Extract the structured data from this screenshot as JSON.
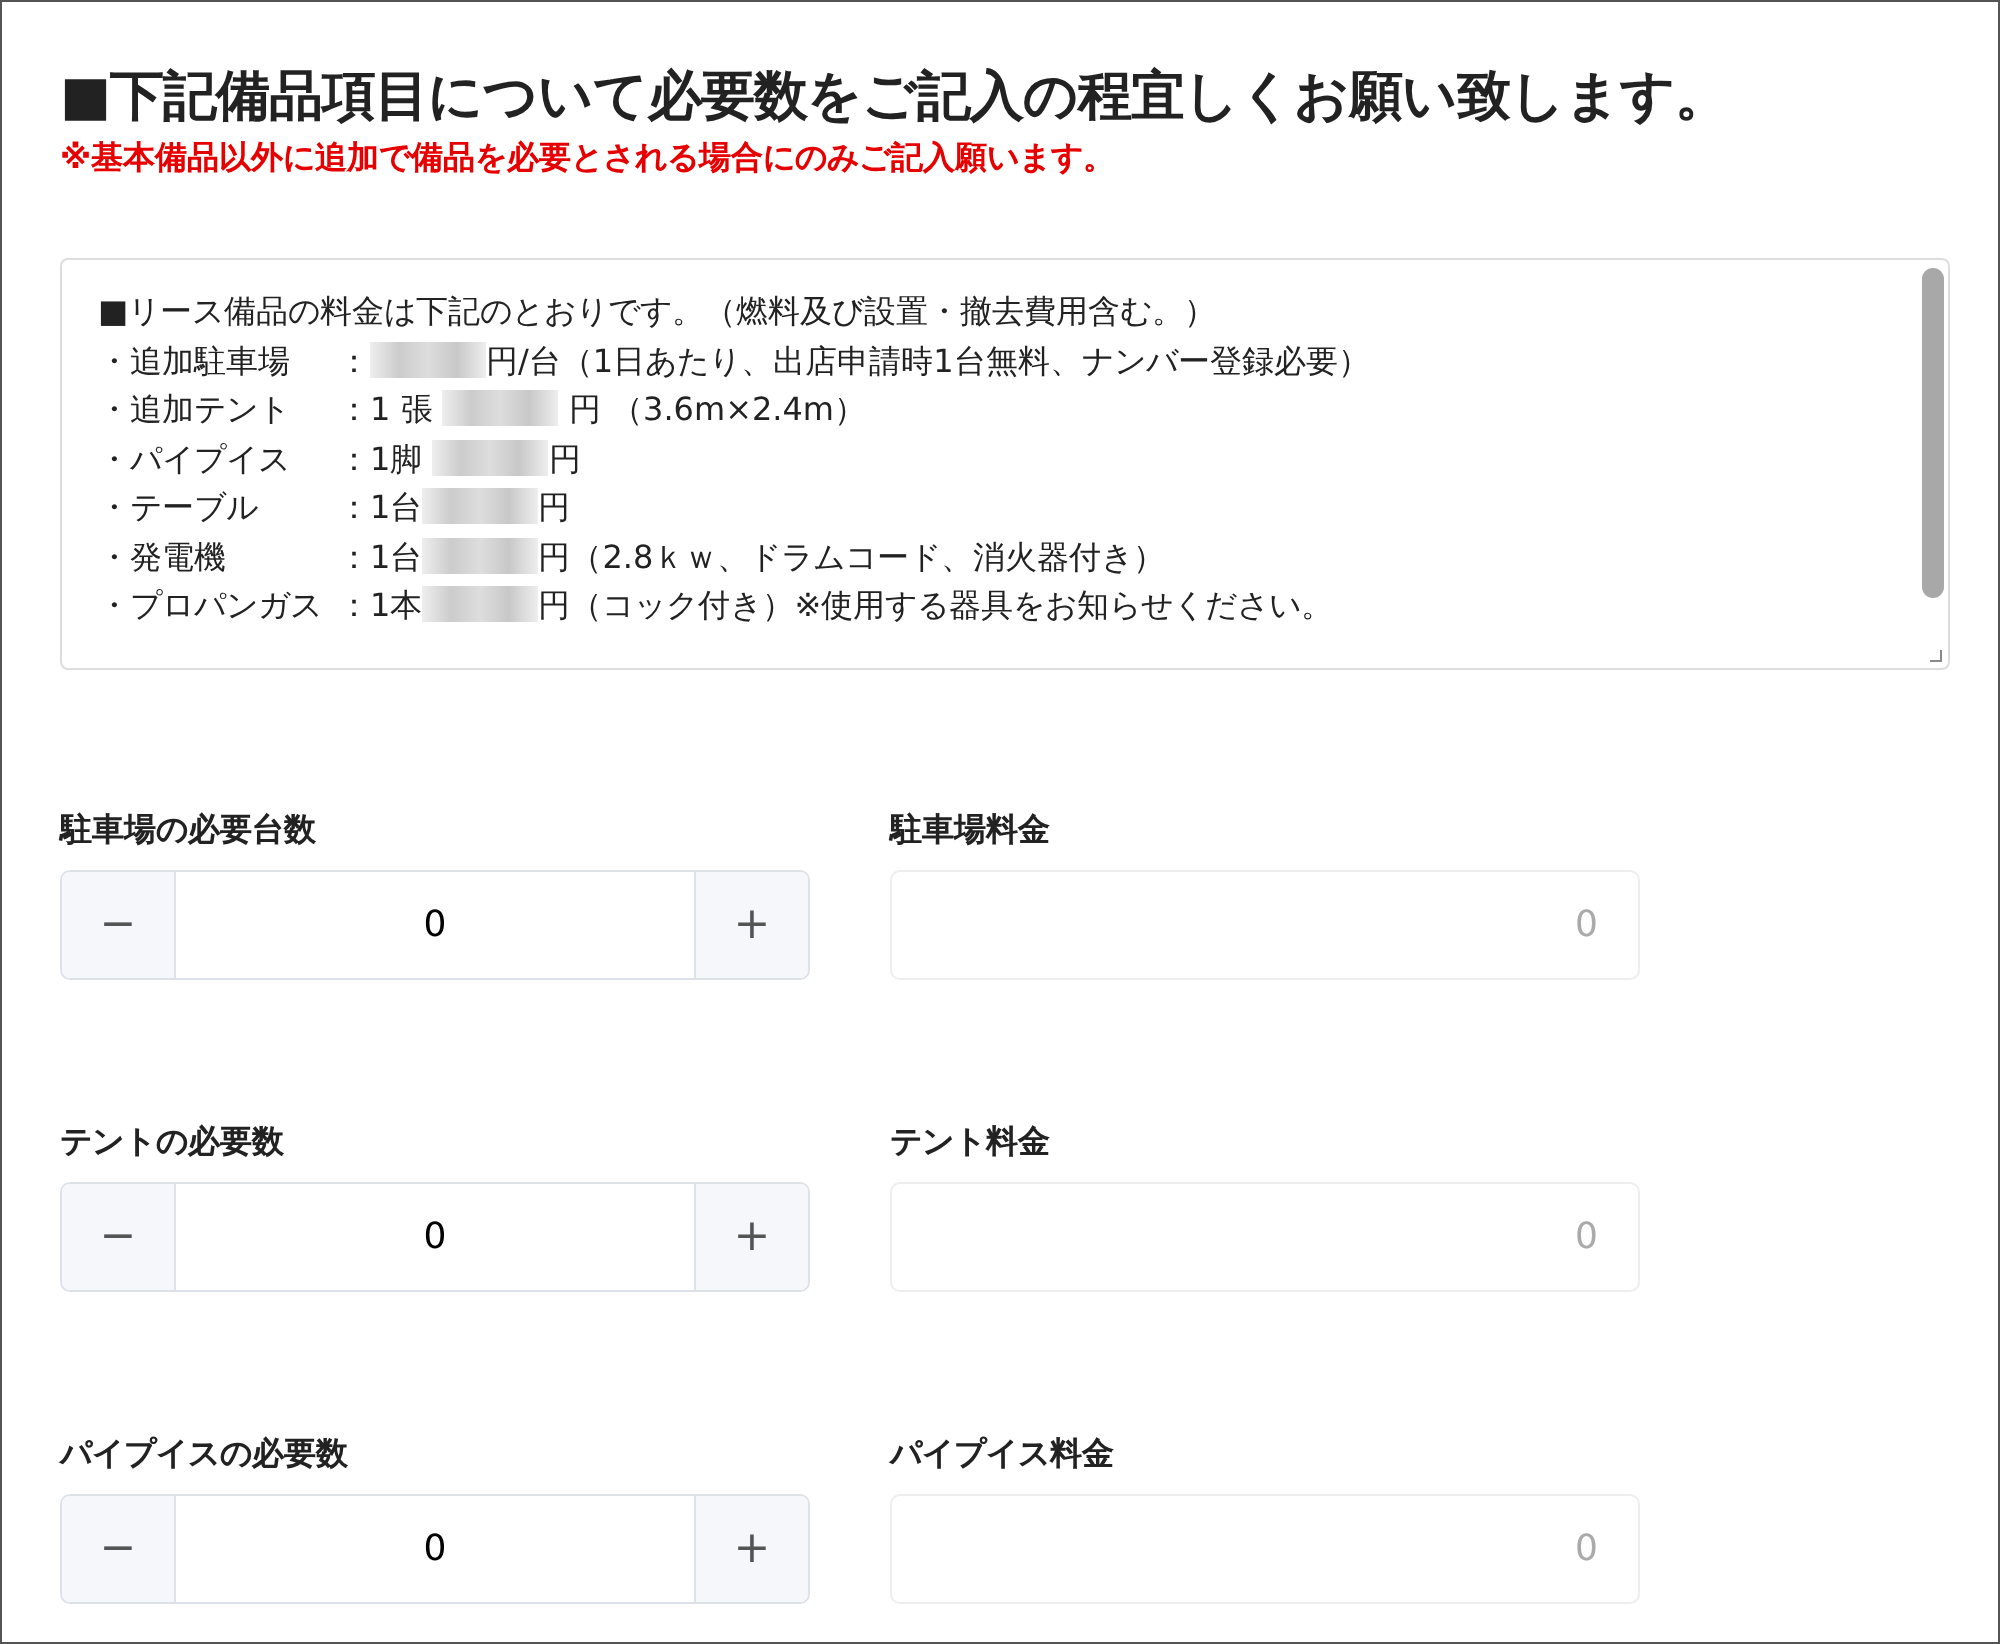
{
  "heading": "■下記備品項目について必要数をご記入の程宜しくお願い致します。",
  "notice": "※基本備品以外に追加で備品を必要とされる場合にのみご記入願います。",
  "price_list": {
    "intro": "■リース備品の料金は下記のとおりです。（燃料及び設置・撤去費用含む。）",
    "lines": [
      {
        "label": "・追加駐車場",
        "before": "：",
        "redacted": true,
        "after": "円/台（1日あたり、出店申請時1台無料、ナンバー登録必要）"
      },
      {
        "label": "・追加テント",
        "before": "：1 張 ",
        "redacted": true,
        "after": " 円 （3.6m×2.4m）"
      },
      {
        "label": "・パイプイス",
        "before": "：1脚 ",
        "redacted": true,
        "after": "円"
      },
      {
        "label": "・テーブル",
        "before": "：1台",
        "redacted": true,
        "after": "円"
      },
      {
        "label": "・発電機",
        "before": "：1台",
        "redacted": true,
        "after": "円（2.8ｋｗ、ドラムコード、消火器付き）"
      },
      {
        "label": "・プロパンガス",
        "before": "：1本",
        "redacted": true,
        "after": "円（コック付き）※使用する器具をお知らせください。"
      }
    ]
  },
  "items": [
    {
      "qty_label": "駐車場の必要台数",
      "minus": "−",
      "qty": "0",
      "plus": "+",
      "fee_label": "駐車場料金",
      "fee": "0",
      "fee_disabled": true
    },
    {
      "qty_label": "テントの必要数",
      "minus": "−",
      "qty": "0",
      "plus": "+",
      "fee_label": "テント料金",
      "fee": "0",
      "fee_disabled": true
    },
    {
      "qty_label": "パイプイスの必要数",
      "minus": "−",
      "qty": "0",
      "plus": "+",
      "fee_label": "パイプイス料金",
      "fee": "0",
      "fee_disabled": true
    }
  ]
}
